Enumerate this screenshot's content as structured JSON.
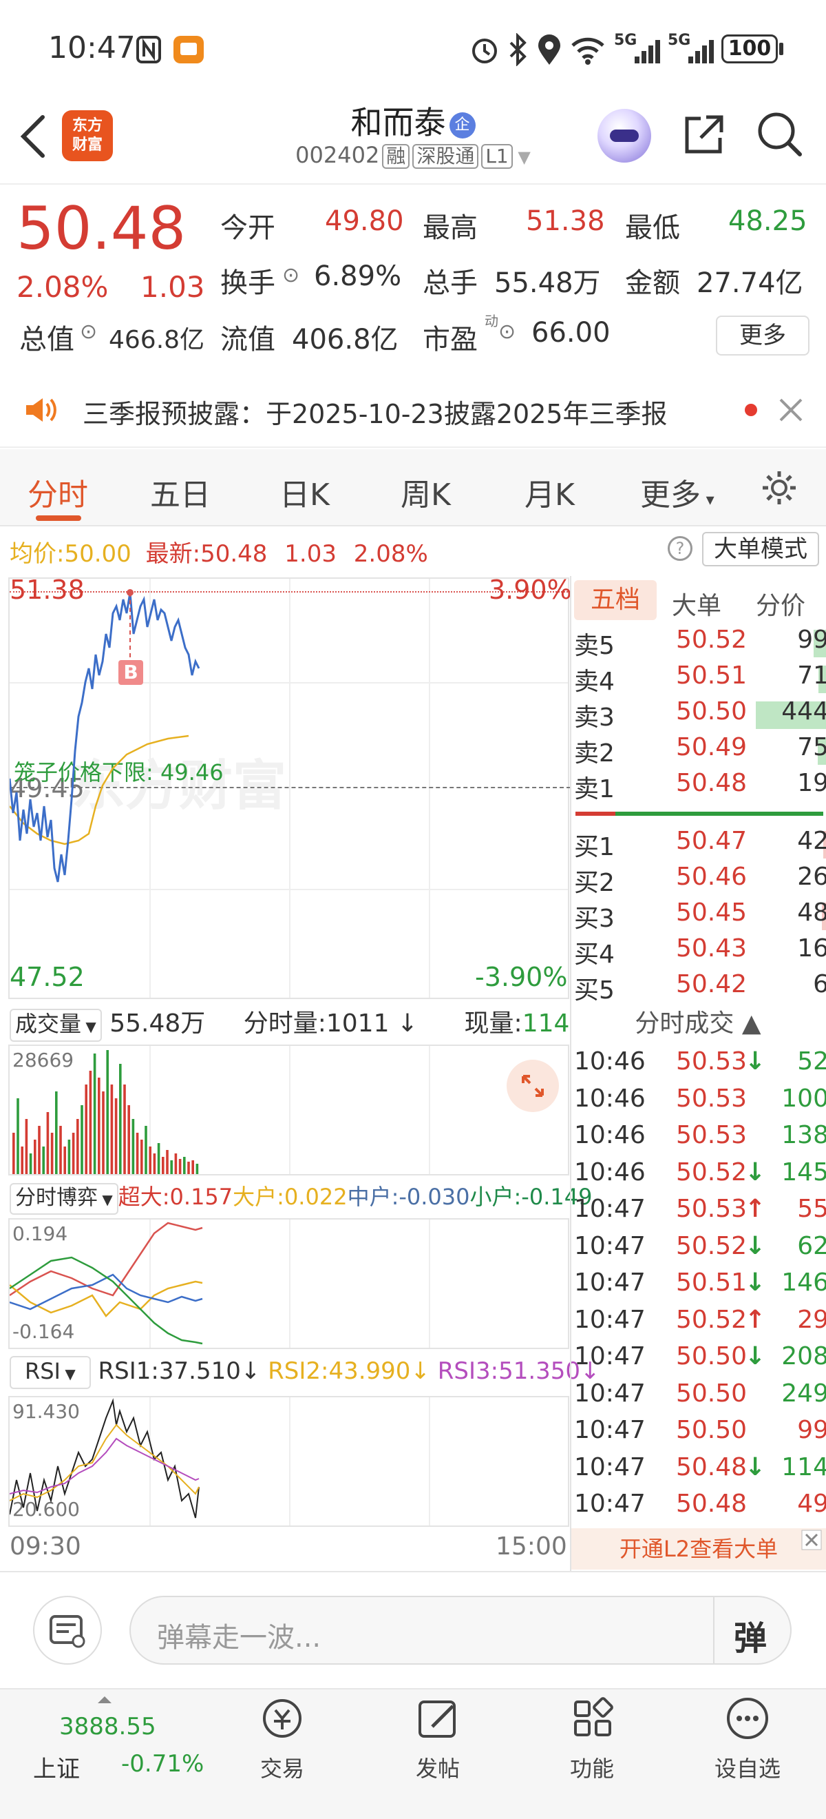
{
  "status_bar": {
    "time": "10:47",
    "signal1": "5G",
    "signal2": "5G",
    "battery": "100"
  },
  "header": {
    "title": "和而泰",
    "title_badge": "企",
    "code": "002402",
    "tags": [
      "融",
      "深股通",
      "L1"
    ],
    "logo_line1": "东方",
    "logo_line2": "财富"
  },
  "quote": {
    "price": "50.48",
    "change_pct": "2.08%",
    "change": "1.03",
    "open_label": "今开",
    "open": "49.80",
    "high_label": "最高",
    "high": "51.38",
    "low_label": "最低",
    "low": "48.25",
    "turnover_label": "换手",
    "turnover": "6.89%",
    "volume_label": "总手",
    "volume": "55.48万",
    "amount_label": "金额",
    "amount": "27.74亿",
    "mktcap_label": "总值",
    "mktcap": "466.8亿",
    "float_label": "流值",
    "float": "406.8亿",
    "pe_label": "市盈",
    "pe_sup": "动",
    "pe": "66.00",
    "more": "更多"
  },
  "notice": {
    "text": "三季报预披露：于2025-10-23披露2025年三季报"
  },
  "tabs": [
    "分时",
    "五日",
    "日K",
    "周K",
    "月K",
    "更多"
  ],
  "info_line": {
    "avg_label": "均价:",
    "avg": "50.00",
    "latest_label": "最新:",
    "latest": "50.48",
    "chg": "1.03",
    "pct": "2.08%",
    "big_mode": "大单模式"
  },
  "chart": {
    "top_price": "51.38",
    "top_pct": "3.90%",
    "mid_price": "49.45",
    "bottom_price": "47.52",
    "bottom_pct": "-3.90%",
    "cage_label": "笼子价格下限: 49.46",
    "marker": "B",
    "watermark": "东方财富"
  },
  "volume_panel": {
    "selector": "成交量",
    "total": "55.48万",
    "minute_label": "分时量:1011",
    "now_label": "现量:",
    "now": "114",
    "max": "28669"
  },
  "flow_panel": {
    "selector": "分时博弈",
    "super": "超大:0.157",
    "big": "大户:0.022",
    "mid": "中户:-0.030",
    "small": "小户:-0.149",
    "max": "0.194",
    "min": "-0.164"
  },
  "rsi_panel": {
    "selector": "RSI",
    "rsi1": "RSI1:37.510",
    "rsi2": "RSI2:43.990",
    "rsi3": "RSI3:51.350",
    "max": "91.430",
    "min": "20.600"
  },
  "time_axis": {
    "start": "09:30",
    "end": "15:00"
  },
  "orderbook": {
    "tabs": [
      "五档",
      "大单",
      "分价"
    ],
    "asks": [
      {
        "label": "卖5",
        "price": "50.52",
        "vol": "99"
      },
      {
        "label": "卖4",
        "price": "50.51",
        "vol": "71"
      },
      {
        "label": "卖3",
        "price": "50.50",
        "vol": "444"
      },
      {
        "label": "卖2",
        "price": "50.49",
        "vol": "75"
      },
      {
        "label": "卖1",
        "price": "50.48",
        "vol": "19"
      }
    ],
    "bids": [
      {
        "label": "买1",
        "price": "50.47",
        "vol": "42"
      },
      {
        "label": "买2",
        "price": "50.46",
        "vol": "26"
      },
      {
        "label": "买3",
        "price": "50.45",
        "vol": "48"
      },
      {
        "label": "买4",
        "price": "50.43",
        "vol": "16"
      },
      {
        "label": "买5",
        "price": "50.42",
        "vol": "6"
      }
    ]
  },
  "ticks": {
    "title": "分时成交",
    "rows": [
      {
        "t": "10:46",
        "p": "50.53",
        "a": "↓",
        "v": "52",
        "c": "green"
      },
      {
        "t": "10:46",
        "p": "50.53",
        "a": "",
        "v": "100",
        "c": "green"
      },
      {
        "t": "10:46",
        "p": "50.53",
        "a": "",
        "v": "138",
        "c": "green"
      },
      {
        "t": "10:46",
        "p": "50.52",
        "a": "↓",
        "v": "145",
        "c": "green"
      },
      {
        "t": "10:47",
        "p": "50.53",
        "a": "↑",
        "v": "55",
        "c": "red"
      },
      {
        "t": "10:47",
        "p": "50.52",
        "a": "↓",
        "v": "62",
        "c": "green"
      },
      {
        "t": "10:47",
        "p": "50.51",
        "a": "↓",
        "v": "146",
        "c": "green"
      },
      {
        "t": "10:47",
        "p": "50.52",
        "a": "↑",
        "v": "29",
        "c": "red"
      },
      {
        "t": "10:47",
        "p": "50.50",
        "a": "↓",
        "v": "208",
        "c": "green"
      },
      {
        "t": "10:47",
        "p": "50.50",
        "a": "",
        "v": "249",
        "c": "green"
      },
      {
        "t": "10:47",
        "p": "50.50",
        "a": "",
        "v": "99",
        "c": "red"
      },
      {
        "t": "10:47",
        "p": "50.48",
        "a": "↓",
        "v": "114",
        "c": "green"
      },
      {
        "t": "10:47",
        "p": "50.48",
        "a": "",
        "v": "49",
        "c": "red"
      }
    ],
    "l2": "开通L2查看大单"
  },
  "comment": {
    "placeholder": "弹幕走一波...",
    "send": "弹"
  },
  "nav": {
    "index_value": "3888.55",
    "index_name": "上证",
    "index_change": "-0.71%",
    "trade": "交易",
    "post": "发帖",
    "func": "功能",
    "watch": "设自选"
  }
}
